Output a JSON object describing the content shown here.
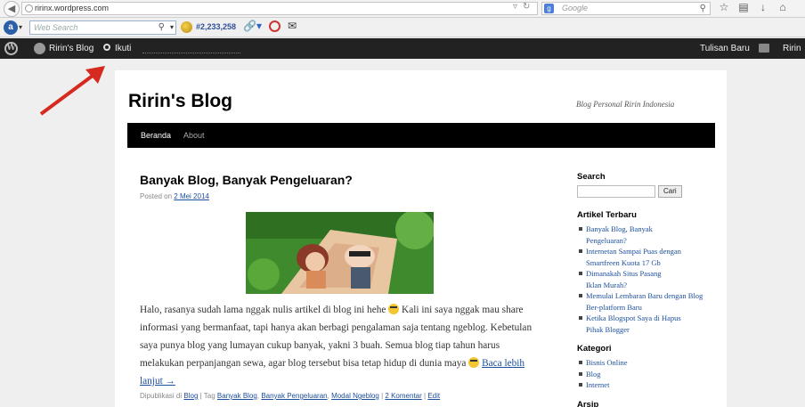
{
  "browser": {
    "url": "ririnx.wordpress.com",
    "search_engine_placeholder": "Google",
    "web_search_placeholder": "Web Search",
    "alexa_rank": "#2,233,258"
  },
  "adminbar": {
    "site_name": "Ririn's Blog",
    "follow_label": "Ikuti",
    "new_post_label": "Tulisan Baru",
    "user_label": "Ririn"
  },
  "blog": {
    "title": "Ririn's Blog",
    "tagline": "Blog Personal Ririn Indonesia",
    "nav": [
      {
        "label": "Beranda"
      },
      {
        "label": "About"
      }
    ]
  },
  "post": {
    "title": "Banyak Blog, Banyak Pengeluaran?",
    "posted_on": "Posted on",
    "date": "2 Mei 2014",
    "body_1": "Halo, rasanya sudah lama nggak nulis artikel di blog ini hehe",
    "body_2": "Kali ini saya nggak mau share informasi yang bermanfaat, tapi hanya akan berbagi pengalaman saja tentang ngeblog. Kebetulan saya punya blog yang lumayan cukup banyak, yakni 3 buah. Semua blog tiap tahun harus melakukan perpanjangan sewa, agar blog tersebut bisa tetap hidup di dunia maya",
    "read_more": "Baca lebih lanjut →",
    "footer": {
      "published_in": "Dipublikasi di",
      "category": "Blog",
      "tag_label": "| Tag",
      "tags": [
        "Banyak Blog",
        "Banyak Pengeluaran",
        "Modal Ngeblog"
      ],
      "comma": ",",
      "sep": "|",
      "comments": "2 Komentar",
      "edit": "Edit"
    }
  },
  "sidebar": {
    "search_title": "Search",
    "search_button": "Cari",
    "recent_title": "Artikel Terbaru",
    "recent": [
      "Banyak Blog, Banyak Pengeluaran?",
      "Internetan Sampai Puas dengan Smartfreen Kuota 17 Gb",
      "Dimanakah Situs Pasang Iklan Murah?",
      "Memulai Lembaran Baru dengan Blog Ber-platform Baru",
      "Ketika Blogspot Saya di Hapus Pihak Blogger"
    ],
    "categories_title": "Kategori",
    "categories": [
      "Bisnis Online",
      "Blog",
      "Internet"
    ],
    "archive_title": "Arsip"
  },
  "colors": {
    "admin_bar": "#222222",
    "nav_bar": "#000000",
    "link": "#1b4e9b",
    "arrow": "#d62a20"
  }
}
